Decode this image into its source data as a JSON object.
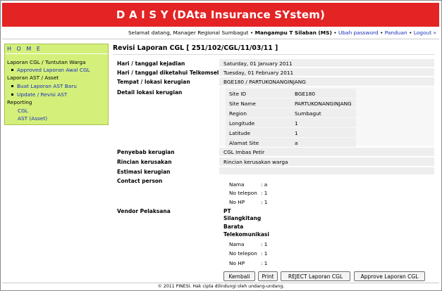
{
  "header": {
    "title": "D A I S Y (DAta Insurance SYstem)"
  },
  "welcome": {
    "greeting": "Selamat datang, Manager Regional Sumbagut •",
    "user": "Mangampu T Silaban (MS)",
    "sep": "•",
    "links": [
      "Ubah password",
      "Panduan",
      "Logout"
    ],
    "tail": "»"
  },
  "sidebar": {
    "home": "H O M E",
    "sections": [
      {
        "label": "Laporan CGL / Tuntutan Warga",
        "items": [
          "Approved Laporan Awal CGL"
        ]
      },
      {
        "label": "Laporan AST / Asset",
        "items": [
          "Buat Laporan AST Baru",
          "Update / Revisi AST"
        ]
      },
      {
        "label": "Reporting",
        "items": [
          "CGL",
          "AST (Asset)"
        ]
      }
    ]
  },
  "main": {
    "title": "Revisi Laporan CGL [ 251/102/CGL/11/03/11 ]",
    "fields": [
      {
        "label": "Hari / tanggal kejadian",
        "value": "Saturday, 01 January 2011"
      },
      {
        "label": "Hari / tanggal diketahui Telkomsel",
        "value": "Tuesday, 01 February 2011"
      },
      {
        "label": "Tempat / lokasi kerugian",
        "value": "BGE180 / PARTUKONANGINJANG"
      },
      {
        "label": "Detail lokasi kerugian",
        "value": ""
      }
    ],
    "site_details": [
      {
        "label": "Site ID",
        "value": "BGE180"
      },
      {
        "label": "Site Name",
        "value": "PARTUKONANGINJANG"
      },
      {
        "label": "Region",
        "value": "Sumbagut"
      },
      {
        "label": "Longitude",
        "value": "1"
      },
      {
        "label": "Latitude",
        "value": "1"
      },
      {
        "label": "Alamat Site",
        "value": "a"
      }
    ],
    "cause": {
      "label": "Penyebab kerugian",
      "value": "CGL Imbas Petir"
    },
    "detail": {
      "label": "Rincian kerusakan",
      "value": "Rincian kerusakan warga"
    },
    "estimate": {
      "label": "Estimasi kerugian",
      "value": ""
    },
    "contact": {
      "label": "Contact person",
      "rows": [
        {
          "label": "Nama",
          "value": ": a"
        },
        {
          "label": "No telepon",
          "value": ": 1"
        },
        {
          "label": "No HP",
          "value": ": 1"
        }
      ]
    },
    "vendor": {
      "label": "Vendor Pelaksana",
      "name_lines": [
        "PT",
        "Silangkitang",
        "Barata",
        "Telekomunikasi"
      ],
      "rows": [
        {
          "label": "Nama",
          "value": ": 1"
        },
        {
          "label": "No telepon",
          "value": ": 1"
        },
        {
          "label": "No HP",
          "value": ": 1"
        }
      ]
    },
    "buttons": {
      "back": "Kembali",
      "print": "Print",
      "reject": "REJECT Laporan CGL",
      "approve": "Approve Laporan CGL"
    }
  },
  "footer": {
    "text": "© 2011 PINESI. Hak cipta dilindungi oleh undang-undang."
  }
}
